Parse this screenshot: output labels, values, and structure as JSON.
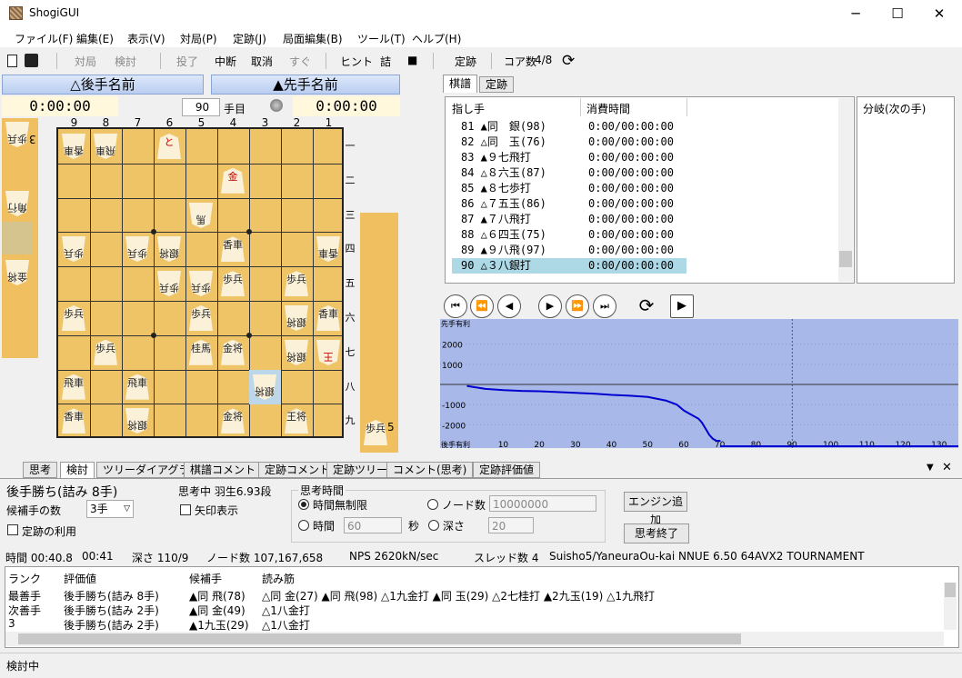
{
  "window": {
    "title": "ShogiGUI",
    "controls": [
      "─",
      "☐",
      "✕"
    ]
  },
  "menu": [
    "ファイル(F)",
    "編集(E)",
    "表示(V)",
    "対局(P)",
    "定跡(J)",
    "局面編集(B)",
    "ツール(T)",
    "ヘルプ(H)"
  ],
  "toolbar": {
    "items": [
      "対局",
      "検討",
      "投了",
      "中断",
      "取消",
      "すぐ",
      "ヒント",
      "詰",
      "■",
      "定跡",
      "コア数"
    ],
    "cores": "4/8"
  },
  "players": {
    "gote_name": "△後手名前",
    "sente_name": "▲先手名前",
    "gote_time": "0:00:00",
    "sente_time": "0:00:00",
    "move_no": "90",
    "move_suffix": "手目"
  },
  "board": {
    "cols": [
      "9",
      "8",
      "7",
      "6",
      "5",
      "4",
      "3",
      "2",
      "1"
    ],
    "rows": [
      "一",
      "二",
      "三",
      "四",
      "五",
      "六",
      "七",
      "八",
      "九"
    ],
    "pieces": [
      {
        "c": 0,
        "r": 0,
        "t": "香車",
        "g": true
      },
      {
        "c": 1,
        "r": 0,
        "t": "飛車",
        "g": true
      },
      {
        "c": 3,
        "r": 0,
        "t": "と",
        "g": false,
        "red": true
      },
      {
        "c": 5,
        "r": 1,
        "t": "金",
        "g": false,
        "red": true
      },
      {
        "c": 4,
        "r": 2,
        "t": "馬",
        "g": true
      },
      {
        "c": 0,
        "r": 3,
        "t": "歩兵",
        "g": true
      },
      {
        "c": 2,
        "r": 3,
        "t": "歩兵",
        "g": true
      },
      {
        "c": 3,
        "r": 3,
        "t": "銀将",
        "g": true
      },
      {
        "c": 5,
        "r": 3,
        "t": "香車",
        "g": false
      },
      {
        "c": 8,
        "r": 3,
        "t": "香車",
        "g": true
      },
      {
        "c": 3,
        "r": 4,
        "t": "歩兵",
        "g": true
      },
      {
        "c": 4,
        "r": 4,
        "t": "歩兵",
        "g": true
      },
      {
        "c": 5,
        "r": 4,
        "t": "歩兵",
        "g": false
      },
      {
        "c": 7,
        "r": 4,
        "t": "歩兵",
        "g": false
      },
      {
        "c": 0,
        "r": 5,
        "t": "歩兵",
        "g": false
      },
      {
        "c": 4,
        "r": 5,
        "t": "歩兵",
        "g": false
      },
      {
        "c": 7,
        "r": 5,
        "t": "銀将",
        "g": true
      },
      {
        "c": 8,
        "r": 5,
        "t": "香車",
        "g": false
      },
      {
        "c": 1,
        "r": 6,
        "t": "歩兵",
        "g": false
      },
      {
        "c": 4,
        "r": 6,
        "t": "桂馬",
        "g": false
      },
      {
        "c": 5,
        "r": 6,
        "t": "金将",
        "g": false
      },
      {
        "c": 7,
        "r": 6,
        "t": "銀将",
        "g": true
      },
      {
        "c": 8,
        "r": 6,
        "t": "王",
        "g": true,
        "red": true
      },
      {
        "c": 0,
        "r": 7,
        "t": "飛車",
        "g": false
      },
      {
        "c": 2,
        "r": 7,
        "t": "飛車",
        "g": false
      },
      {
        "c": 6,
        "r": 7,
        "t": "銀将",
        "g": true,
        "hl": true
      },
      {
        "c": 0,
        "r": 8,
        "t": "香車",
        "g": false
      },
      {
        "c": 2,
        "r": 8,
        "t": "銀将",
        "g": true
      },
      {
        "c": 5,
        "r": 8,
        "t": "金将",
        "g": false
      },
      {
        "c": 7,
        "r": 8,
        "t": "王将",
        "g": false
      }
    ],
    "gote_hand": [
      {
        "t": "歩兵",
        "n": "3"
      },
      {
        "t": "角行",
        "n": ""
      },
      {
        "t": "金将",
        "n": ""
      }
    ],
    "sente_hand": [
      {
        "t": "歩兵",
        "n": "5"
      }
    ]
  },
  "kifu": {
    "tabs": [
      "棋譜",
      "定跡"
    ],
    "headers": [
      "指し手",
      "消費時間",
      "分岐(次の手)"
    ],
    "rows": [
      {
        "move": "81 ▲同　銀(98)",
        "time": "0:00/00:00:00"
      },
      {
        "move": "82 △同　玉(76)",
        "time": "0:00/00:00:00"
      },
      {
        "move": "83 ▲９七飛打",
        "time": "0:00/00:00:00"
      },
      {
        "move": "84 △８六玉(87)",
        "time": "0:00/00:00:00"
      },
      {
        "move": "85 ▲８七歩打",
        "time": "0:00/00:00:00"
      },
      {
        "move": "86 △７五玉(86)",
        "time": "0:00/00:00:00"
      },
      {
        "move": "87 ▲７八飛打",
        "time": "0:00/00:00:00"
      },
      {
        "move": "88 △６四玉(75)",
        "time": "0:00/00:00:00"
      },
      {
        "move": "89 ▲９八飛(97)",
        "time": "0:00/00:00:00"
      },
      {
        "move": "90 △３八銀打",
        "time": "0:00/00:00:00"
      }
    ]
  },
  "chart_data": {
    "type": "line",
    "top_label": "先手有利",
    "bottom_label": "後手有利",
    "x_ticks": [
      10,
      20,
      30,
      40,
      50,
      60,
      70,
      80,
      90,
      100,
      110,
      120,
      130
    ],
    "y_ticks": [
      2000,
      1000,
      -1000,
      -2000
    ],
    "ylim": [
      -2800,
      2800
    ],
    "xlim": [
      0,
      135
    ],
    "series": [
      {
        "x": [
          0,
          5,
          10,
          15,
          20,
          25,
          30,
          35,
          40,
          45,
          50,
          55,
          58,
          60,
          62,
          64,
          65,
          66,
          67,
          68,
          69,
          70
        ],
        "y": [
          -80,
          -220,
          -280,
          -320,
          -340,
          -380,
          -420,
          -460,
          -520,
          -560,
          -620,
          -800,
          -1000,
          -1300,
          -1500,
          -1700,
          -1900,
          -2200,
          -2500,
          -2700,
          -2800,
          -2800
        ]
      }
    ]
  },
  "nav_buttons": [
    "⏮",
    "⏪",
    "◀",
    "▶",
    "⏩",
    "⏭",
    "⟳",
    "▶"
  ],
  "bottom_tabs": [
    "思考",
    "検討",
    "ツリーダイアグラム",
    "棋譜コメント",
    "定跡コメント",
    "定跡ツリー",
    "コメント(思考)",
    "定跡評価値"
  ],
  "analysis": {
    "result": "後手勝ち(詰み 8手)",
    "thinking": "思考中 羽生6.93段",
    "candidates_label": "候補手の数",
    "candidates_value": "3手",
    "arrow_label": "矢印表示",
    "book_label": "定跡の利用",
    "time_group": "思考時間",
    "unlimited": "時間無制限",
    "node_label": "ノード数",
    "node_value": "10000000",
    "time_label": "時間",
    "time_value": "60",
    "sec": "秒",
    "depth_label": "深さ",
    "depth_value": "20",
    "add_engine": "エンジン追加",
    "stop": "思考終了"
  },
  "status": {
    "time": "時間  00:40.8",
    "elapsed": "00:41",
    "depth": "深さ    110/9",
    "nodes": "ノード数  107,167,658",
    "nps": "NPS  2620kN/sec",
    "threads": "スレッド数  4",
    "engine": "Suisho5/YaneuraOu-kai NNUE 6.50 64AVX2 TOURNAMENT"
  },
  "pv": {
    "headers": [
      "ランク",
      "評価値",
      "候補手",
      "読み筋"
    ],
    "rows": [
      {
        "rank": "最善手",
        "eval": "後手勝ち(詰み 8手)",
        "move": "▲同  飛(78)",
        "line": "△同  金(27) ▲同  飛(98) △1九金打 ▲同  玉(29) △2七桂打 ▲2九玉(19) △1九飛打"
      },
      {
        "rank": "次善手",
        "eval": "後手勝ち(詰み 2手)",
        "move": "▲同  金(49)",
        "line": "△1八金打"
      },
      {
        "rank": "3",
        "eval": "後手勝ち(詰み 2手)",
        "move": "▲1九玉(29)",
        "line": "△1八金打"
      }
    ]
  },
  "footer": "検討中"
}
